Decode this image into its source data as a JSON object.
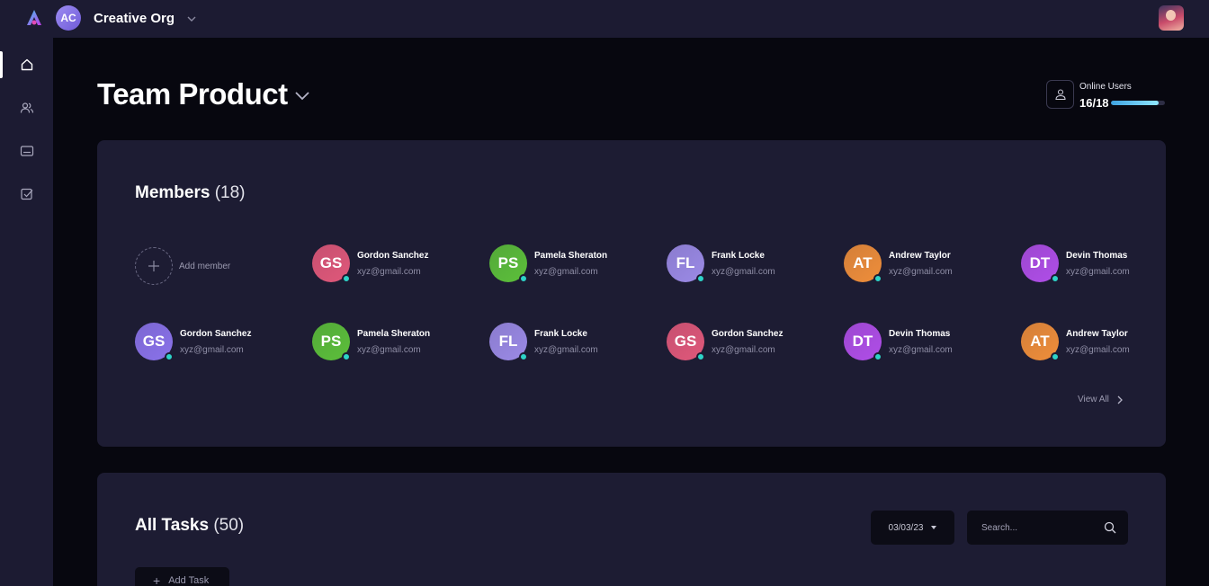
{
  "topbar": {
    "org_initials": "AC",
    "org_name": "Creative Org"
  },
  "sidebar": {
    "items": [
      {
        "icon": "home-icon",
        "active": true
      },
      {
        "icon": "users-icon",
        "active": false
      },
      {
        "icon": "card-icon",
        "active": false
      },
      {
        "icon": "task-check-icon",
        "active": false
      }
    ]
  },
  "page": {
    "title": "Team Product"
  },
  "online_users": {
    "label": "Online Users",
    "count_text": "16/18",
    "fraction": 0.889
  },
  "members": {
    "title": "Members",
    "count": "(18)",
    "add_label": "Add member",
    "view_all": "View All",
    "list": [
      {
        "initials": "GS",
        "name": "Gordon Sanchez",
        "email": "xyz@gmail.com",
        "color": "#e0587a"
      },
      {
        "initials": "PS",
        "name": "Pamela Sheraton",
        "email": "xyz@gmail.com",
        "color": "#5cbf3a"
      },
      {
        "initials": "FL",
        "name": "Frank Locke",
        "email": "xyz@gmail.com",
        "color": "#9b8ae6"
      },
      {
        "initials": "AT",
        "name": "Andrew Taylor",
        "email": "xyz@gmail.com",
        "color": "#ef8e3a"
      },
      {
        "initials": "DT",
        "name": "Devin Thomas",
        "email": "xyz@gmail.com",
        "color": "#b04ee8"
      },
      {
        "initials": "GS",
        "name": "Gordon Sanchez",
        "email": "xyz@gmail.com",
        "color": "#8a72ea"
      },
      {
        "initials": "PS",
        "name": "Pamela Sheraton",
        "email": "xyz@gmail.com",
        "color": "#5cbf3a"
      },
      {
        "initials": "FL",
        "name": "Frank Locke",
        "email": "xyz@gmail.com",
        "color": "#9b8ae6"
      },
      {
        "initials": "GS",
        "name": "Gordon Sanchez",
        "email": "xyz@gmail.com",
        "color": "#e0587a"
      },
      {
        "initials": "DT",
        "name": "Devin Thomas",
        "email": "xyz@gmail.com",
        "color": "#b04ee8"
      },
      {
        "initials": "AT",
        "name": "Andrew Taylor",
        "email": "xyz@gmail.com",
        "color": "#ef8e3a"
      }
    ]
  },
  "tasks": {
    "title": "All Tasks",
    "count": "(50)",
    "date_value": "03/03/23",
    "search_placeholder": "Search...",
    "add_label": "Add Task"
  },
  "colors": {
    "accent": "#2dd3c7",
    "surface": "#1d1c33",
    "background": "#07070f"
  }
}
